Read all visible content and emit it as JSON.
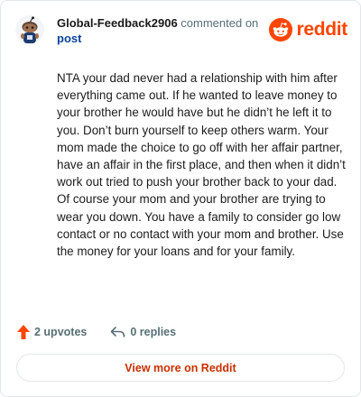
{
  "header": {
    "username": "Global-Feedback2906",
    "action_text": "commented on",
    "post_link": "post",
    "brand_name": "reddit"
  },
  "comment": {
    "body": "NTA your dad never had a relationship with him after everything came out. If he wanted to leave money to your brother he would have but he didn’t he left it to you. Don’t burn yourself to keep others warm. Your mom made the choice to go off with her affair partner, have an affair in the first place, and then when it didn’t work out tried to push your brother back to your dad. Of course your mom and your brother are trying to wear you down. You have a family to consider go low contact or no contact with your mom and brother. Use the money for your loans and for your family."
  },
  "actions": {
    "upvotes": "2 upvotes",
    "replies": "0 replies"
  },
  "footer": {
    "view_more": "View more on Reddit"
  },
  "colors": {
    "brand": "#ff4500",
    "upvote_arrow": "#ff4500",
    "link": "#0a449b",
    "view_more_text": "#c93000"
  },
  "icons": {
    "avatar": "snoo-avatar-icon",
    "brand": "reddit-logo-icon",
    "upvote": "upvote-arrow-icon",
    "reply": "reply-arrow-icon"
  }
}
